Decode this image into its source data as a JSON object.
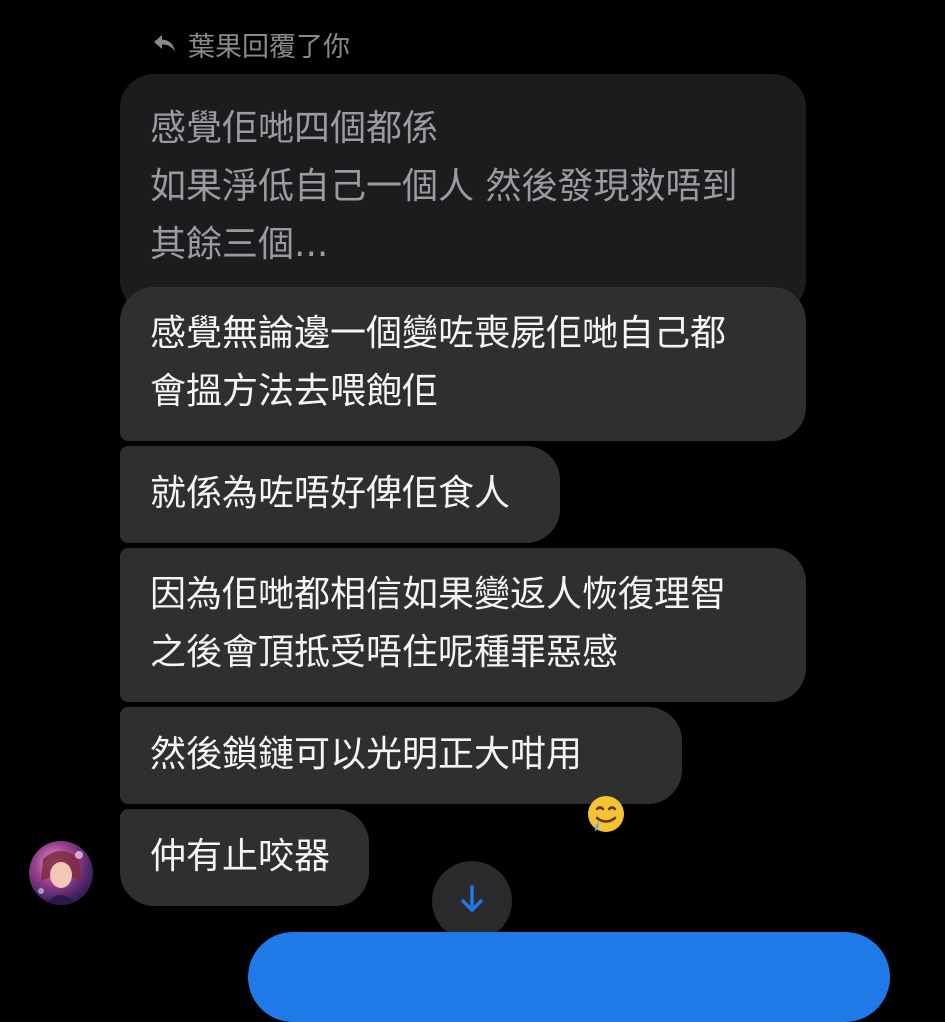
{
  "reply_header": {
    "icon": "reply-arrow-icon",
    "text": "葉果回覆了你"
  },
  "quoted_message": {
    "text": "感覺佢哋四個都係\n如果淨低自己一個人 然後發現救唔到\n其餘三個..."
  },
  "messages": [
    {
      "text": "感覺無論邊一個變咗喪屍佢哋自己都\n會搵方法去喂飽佢"
    },
    {
      "text": "就係為咗唔好俾佢食人"
    },
    {
      "text": "因為佢哋都相信如果變返人恢復理智\n之後會頂抵受唔住呢種罪惡感"
    },
    {
      "text": "然後鎖鏈可以光明正大咁用",
      "emoji": "drooling-face-emoji"
    },
    {
      "text": "仲有止咬器"
    }
  ],
  "sender": {
    "avatar_icon": "avatar"
  },
  "scroll_button": {
    "icon": "arrow-down-icon",
    "color": "#1f7ae8"
  },
  "colors": {
    "background": "#000000",
    "bubble": "#2f2f31",
    "quoted_bubble": "#1c1c1e",
    "accent": "#1f7ae8"
  }
}
